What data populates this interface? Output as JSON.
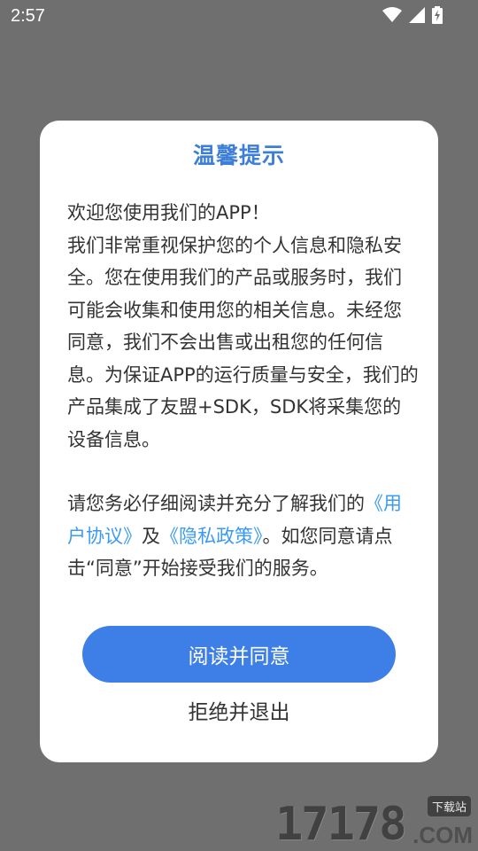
{
  "status_bar": {
    "time": "2:57"
  },
  "dialog": {
    "title": "温馨提示",
    "para1_line1": "欢迎您使用我们的APP！",
    "para1_body": "我们非常重视保护您的个人信息和隐私安全。您在使用我们的产品或服务时，我们可能会收集和使用您的相关信息。未经您同意，我们不会出售或出租您的任何信息。为保证APP的运行质量与安全，我们的产品集成了友盟+SDK，SDK将采集您的设备信息。",
    "para2_before": "请您务必仔细阅读并充分了解我们的",
    "user_agreement_link": "《用户协议》",
    "and_text": "及",
    "privacy_policy_link": "《隐私政策》",
    "para2_after": "。如您同意请点击“同意”开始接受我们的服务。",
    "agree_button": "阅读并同意",
    "decline_button": "拒绝并退出"
  },
  "watermark": {
    "digits": "17178",
    "badge": "下载站",
    "domain": ".COM"
  }
}
